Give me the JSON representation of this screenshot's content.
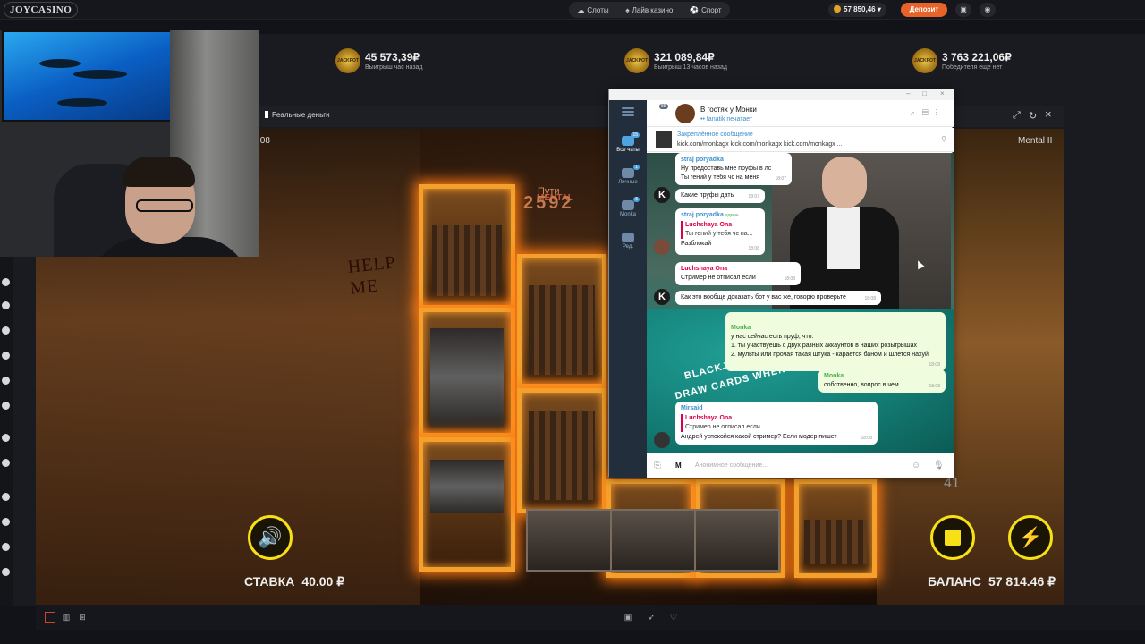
{
  "site": {
    "logo": "JOYCASINO"
  },
  "nav": {
    "slots": "Слоты",
    "live": "Лайв казино",
    "sport": "Спорт"
  },
  "account": {
    "balance": "57 850,46",
    "deposit": "Депозит"
  },
  "jackpots": [
    {
      "badge": "JACKPOT",
      "amount": "45 573,39₽",
      "sub": "Выигрыш час назад"
    },
    {
      "badge": "JACKPOT",
      "amount": "321 089,84₽",
      "sub": "Выигрыш 13 часов назад"
    },
    {
      "badge": "JACKPOT",
      "amount": "3 763 221,06₽",
      "sub": "Победителя еще нет"
    }
  ],
  "game": {
    "mode": "Реальные деньги",
    "timer": ":08",
    "title": "Mental II",
    "wall_text": "HELP\nME",
    "paths_label": "Пути",
    "paths_value": "2592",
    "logo_text": "MENTAL",
    "spins": "41",
    "bet_label": "СТАВКА",
    "bet_value": "40.00 ₽",
    "balance_label": "БАЛАНС",
    "balance_value": "57 814.46 ₽"
  },
  "telegram": {
    "chat_title": "В гостях у Монки",
    "status": "fanatik печатает",
    "unread": "85",
    "sidebar": [
      {
        "label": "Все чаты",
        "badge": "15"
      },
      {
        "label": "Личные",
        "badge": "1"
      },
      {
        "label": "Monka",
        "badge": "6"
      },
      {
        "label": "Ред.",
        "badge": ""
      }
    ],
    "pinned_title": "Закреплённое сообщение",
    "pinned_text": "kick.com/monkagx kick.com/monkagx kick.com/monkagx ...",
    "messages": [
      {
        "name": "straj poryadka",
        "text": "Ну предоставь мне пруфы в лс",
        "extra": "Ты гений у тебя чс на меня",
        "time": "18:07"
      },
      {
        "text": "Какие пруфы дать",
        "time": "18:07"
      },
      {
        "name": "straj poryadka",
        "admin": "админ",
        "reply_name": "Luchshaya Ona",
        "reply_text": "Ты гений у тебя чс на...",
        "text": "Разблокай",
        "time": "18:08"
      },
      {
        "name": "Luchshaya Ona",
        "text": "Стример не отписал если",
        "time": "18:08"
      },
      {
        "text": "Как это вообще доказать бот у вас же, говорю проверьте",
        "time": "18:08"
      },
      {
        "name": "Monka",
        "text": "у нас сейчас есть пруф, что:\n1. ты участвуешь с двух разных аккаунтов в наших розыгрышах\n2. мульты или прочая такая штука - карается баном и шлется нахуй",
        "time": "18:08"
      },
      {
        "name": "Monka",
        "text": "собственно, вопрос в чем",
        "time": "18:08"
      },
      {
        "name": "Mirsaid",
        "reply_name": "Luchshaya Ona",
        "reply_text": "Стример не отписал если",
        "text": "Андрей успокойся какой стример? Если модер пишет",
        "time": "18:08"
      }
    ],
    "input_placeholder": "Анонимное сообщение...",
    "table_text": "BLACKJACK PAYS 3 TO 2",
    "table_text2": "DRAW CARDS WHEN"
  }
}
